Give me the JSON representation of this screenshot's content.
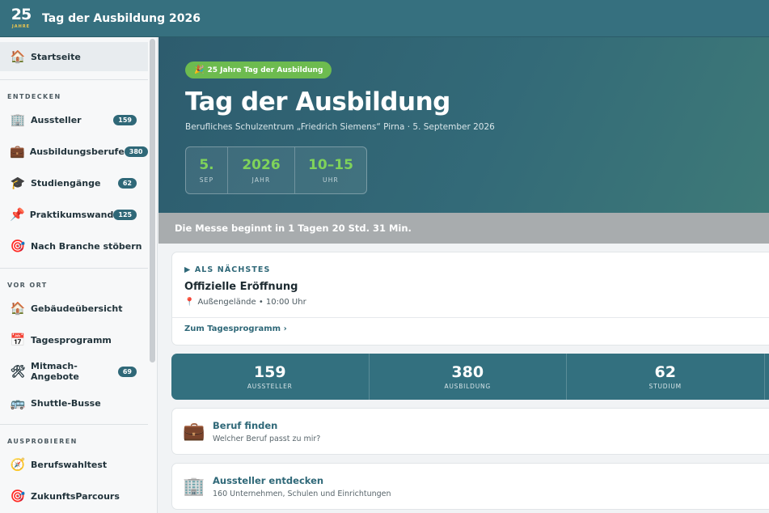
{
  "header": {
    "logo_number": "25",
    "logo_sub": "JAHRE",
    "title": "Tag der Ausbildung 2026"
  },
  "sidebar": {
    "home": {
      "label": "Startseite",
      "icon": "house-icon"
    },
    "sections": [
      {
        "label": "ENTDECKEN",
        "items": [
          {
            "label": "Aussteller",
            "badge": "159",
            "icon": "office-building-icon"
          },
          {
            "label": "Ausbildungsberufe",
            "badge": "380",
            "icon": "briefcase-icon"
          },
          {
            "label": "Studiengänge",
            "badge": "62",
            "icon": "graduation-cap-icon"
          },
          {
            "label": "Praktikumswand",
            "badge": "125",
            "icon": "pushpin-icon"
          },
          {
            "label": "Nach Branche stöbern",
            "badge": "",
            "icon": "target-icon"
          }
        ]
      },
      {
        "label": "VOR ORT",
        "items": [
          {
            "label": "Gebäudeübersicht",
            "badge": "",
            "icon": "house-icon"
          },
          {
            "label": "Tagesprogramm",
            "badge": "",
            "icon": "calendar-icon"
          },
          {
            "label": "Mitmach-Angebote",
            "badge": "69",
            "icon": "tools-icon"
          },
          {
            "label": "Shuttle-Busse",
            "badge": "",
            "icon": "bus-icon"
          }
        ]
      },
      {
        "label": "AUSPROBIEREN",
        "items": [
          {
            "label": "Berufswahltest",
            "badge": "",
            "icon": "compass-icon"
          },
          {
            "label": "ZukunftsParcours",
            "badge": "",
            "icon": "target-icon"
          }
        ]
      }
    ]
  },
  "hero": {
    "pill": "25 Jahre Tag der Ausbildung",
    "title": "Tag der Ausbildung",
    "subtitle": "Berufliches Schulzentrum „Friedrich Siemens“ Pirna · 5. September 2026",
    "date_cells": [
      {
        "value": "5.",
        "label": "SEP"
      },
      {
        "value": "2026",
        "label": "JAHR"
      },
      {
        "value": "10–15",
        "label": "UHR"
      }
    ]
  },
  "countdown": {
    "text": "Die Messe beginnt in 1 Tagen 20 Std. 31 Min."
  },
  "next_event": {
    "kicker": "▶ ALS NÄCHSTES",
    "title": "Offizielle Eröffnung",
    "location": "Außengelände • 10:00 Uhr",
    "link": "Zum Tagesprogramm ›"
  },
  "stats": [
    {
      "value": "159",
      "label": "AUSSTELLER"
    },
    {
      "value": "380",
      "label": "AUSBILDUNG"
    },
    {
      "value": "62",
      "label": "STUDIUM"
    }
  ],
  "features": [
    {
      "title": "Beruf finden",
      "subtitle": "Welcher Beruf passt zu mir?",
      "icon": "briefcase-icon"
    },
    {
      "title": "Aussteller entdecken",
      "subtitle": "160 Unternehmen, Schulen und Einrichtungen",
      "icon": "office-building-icon"
    }
  ],
  "colors": {
    "primary": "#36707f",
    "accent_green": "#6dbb4f",
    "date_value": "#7fd35a",
    "badge": "#2f6878",
    "countdown_bg": "#a8acae"
  }
}
